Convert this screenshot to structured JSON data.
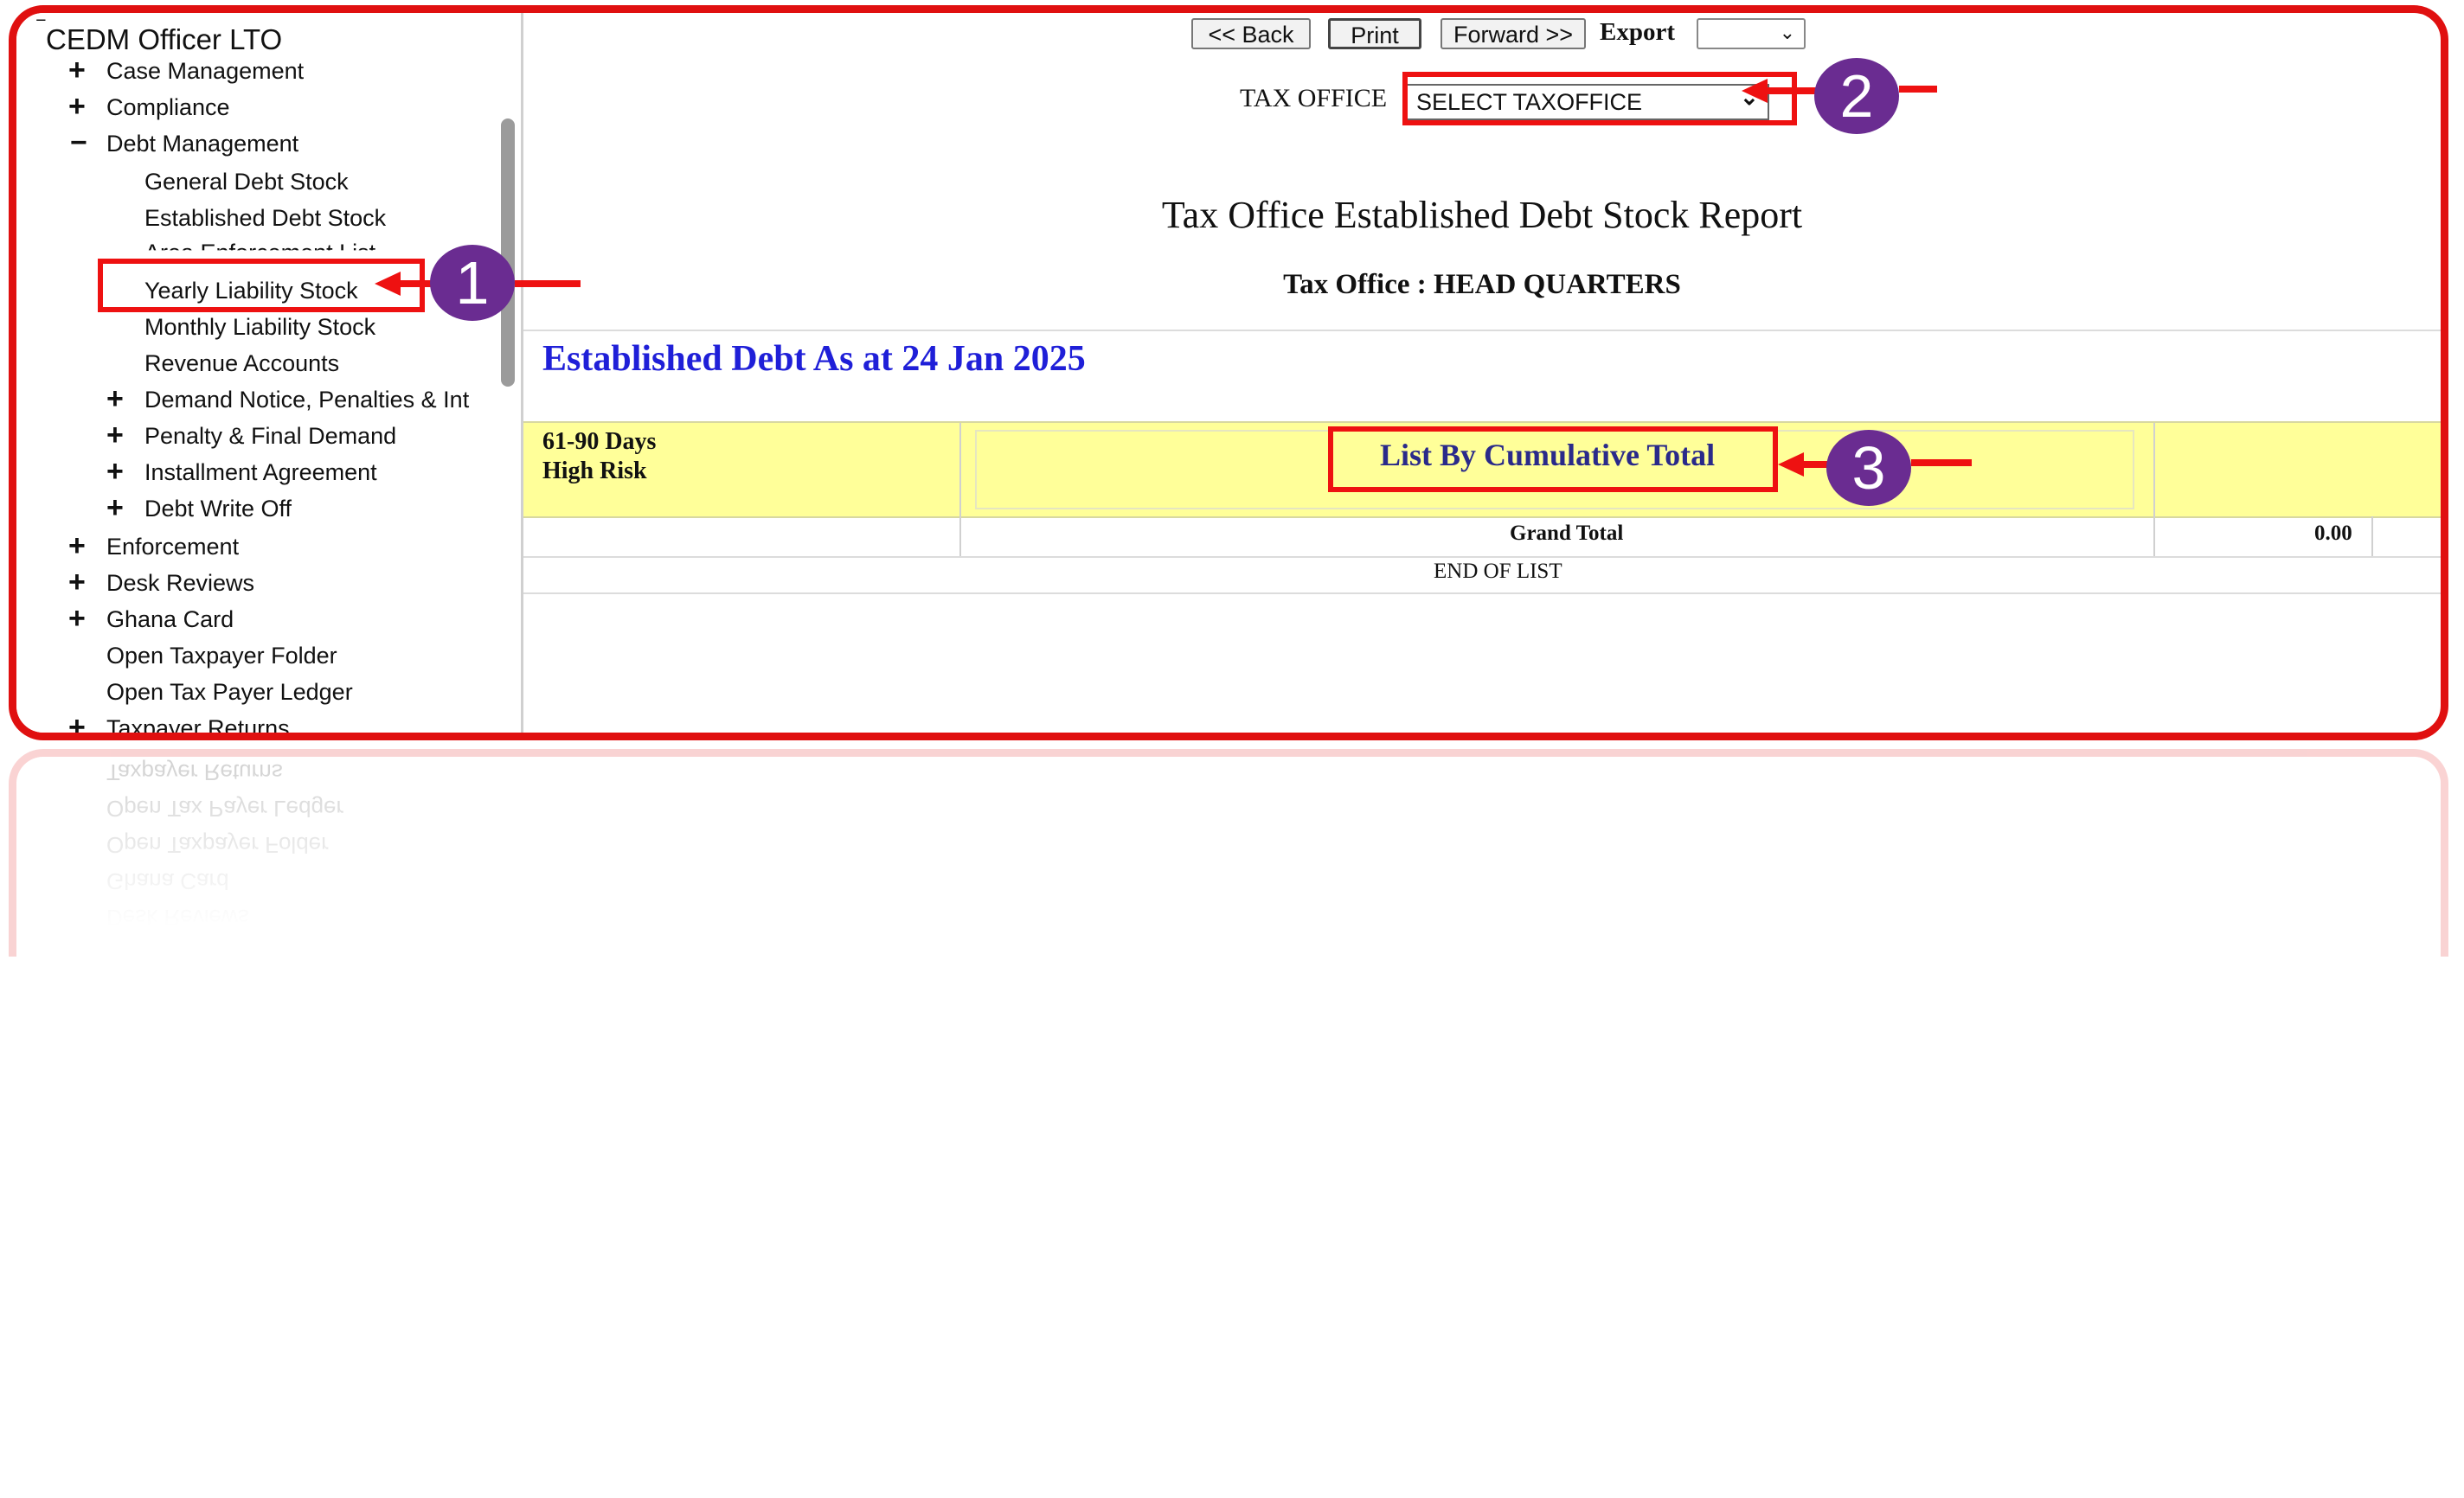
{
  "sidebar": {
    "title": "CEDM Officer LTO",
    "items": [
      {
        "sign": "+",
        "label": "Case Management"
      },
      {
        "sign": "+",
        "label": "Compliance"
      },
      {
        "sign": "−",
        "label": "Debt Management"
      },
      {
        "sign": "",
        "label": "General Debt Stock"
      },
      {
        "sign": "",
        "label": "Established Debt Stock"
      },
      {
        "sign": "",
        "label": "Area Enforcement List"
      },
      {
        "sign": "",
        "label": "Yearly Liability Stock"
      },
      {
        "sign": "",
        "label": "Monthly Liability Stock"
      },
      {
        "sign": "",
        "label": "Revenue Accounts"
      },
      {
        "sign": "+",
        "label": "Demand Notice, Penalties & Int"
      },
      {
        "sign": "+",
        "label": "Penalty & Final Demand"
      },
      {
        "sign": "+",
        "label": "Installment Agreement"
      },
      {
        "sign": "+",
        "label": "Debt Write Off"
      },
      {
        "sign": "+",
        "label": "Enforcement"
      },
      {
        "sign": "+",
        "label": "Desk Reviews"
      },
      {
        "sign": "+",
        "label": "Ghana Card"
      },
      {
        "sign": "",
        "label": "Open Taxpayer Folder"
      },
      {
        "sign": "",
        "label": "Open Tax Payer Ledger"
      },
      {
        "sign": "+",
        "label": "Taxpayer Returns"
      }
    ]
  },
  "toolbar": {
    "back": "<< Back",
    "print": "Print",
    "forward": "Forward >>",
    "export": "Export"
  },
  "filter": {
    "label": "TAX OFFICE",
    "selected": "SELECT TAXOFFICE"
  },
  "report": {
    "title": "Tax Office Established Debt Stock Report",
    "office_line": "Tax Office : HEAD QUARTERS",
    "heading": "Established Debt As at 24 Jan 2025",
    "row_label_1": "61-90 Days",
    "row_label_2": "High Risk",
    "list_button": "List By Cumulative Total",
    "grand_total_label": "Grand Total",
    "grand_total_value": "0.00",
    "end": "END OF LIST"
  },
  "annotations": {
    "step1": "1",
    "step2": "2",
    "step3": "3"
  },
  "colors": {
    "frame": "#e01010",
    "badge": "#6a2c91",
    "heading_blue": "#1f1fd8",
    "row_yellow": "#ffff99"
  }
}
